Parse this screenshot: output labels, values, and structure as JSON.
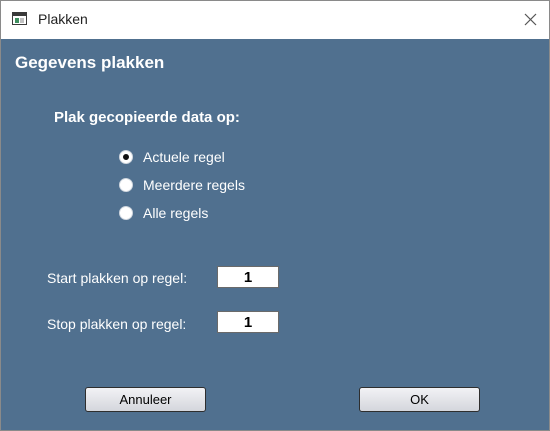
{
  "window": {
    "title": "Plakken",
    "close_glyph": "close-icon"
  },
  "dialog": {
    "heading": "Gegevens plakken",
    "paste_target": {
      "label": "Plak gecopieerde data op:",
      "options": [
        {
          "label": "Actuele regel",
          "selected": true
        },
        {
          "label": "Meerdere regels",
          "selected": false
        },
        {
          "label": "Alle regels",
          "selected": false
        }
      ]
    },
    "start_row": {
      "label": "Start plakken op regel:",
      "value": "1"
    },
    "stop_row": {
      "label": "Stop plakken op regel:",
      "value": "1"
    },
    "buttons": {
      "cancel": "Annuleer",
      "ok": "OK"
    }
  },
  "colors": {
    "background": "#50708f",
    "text": "#ffffff",
    "titlebar": "#ffffff"
  }
}
